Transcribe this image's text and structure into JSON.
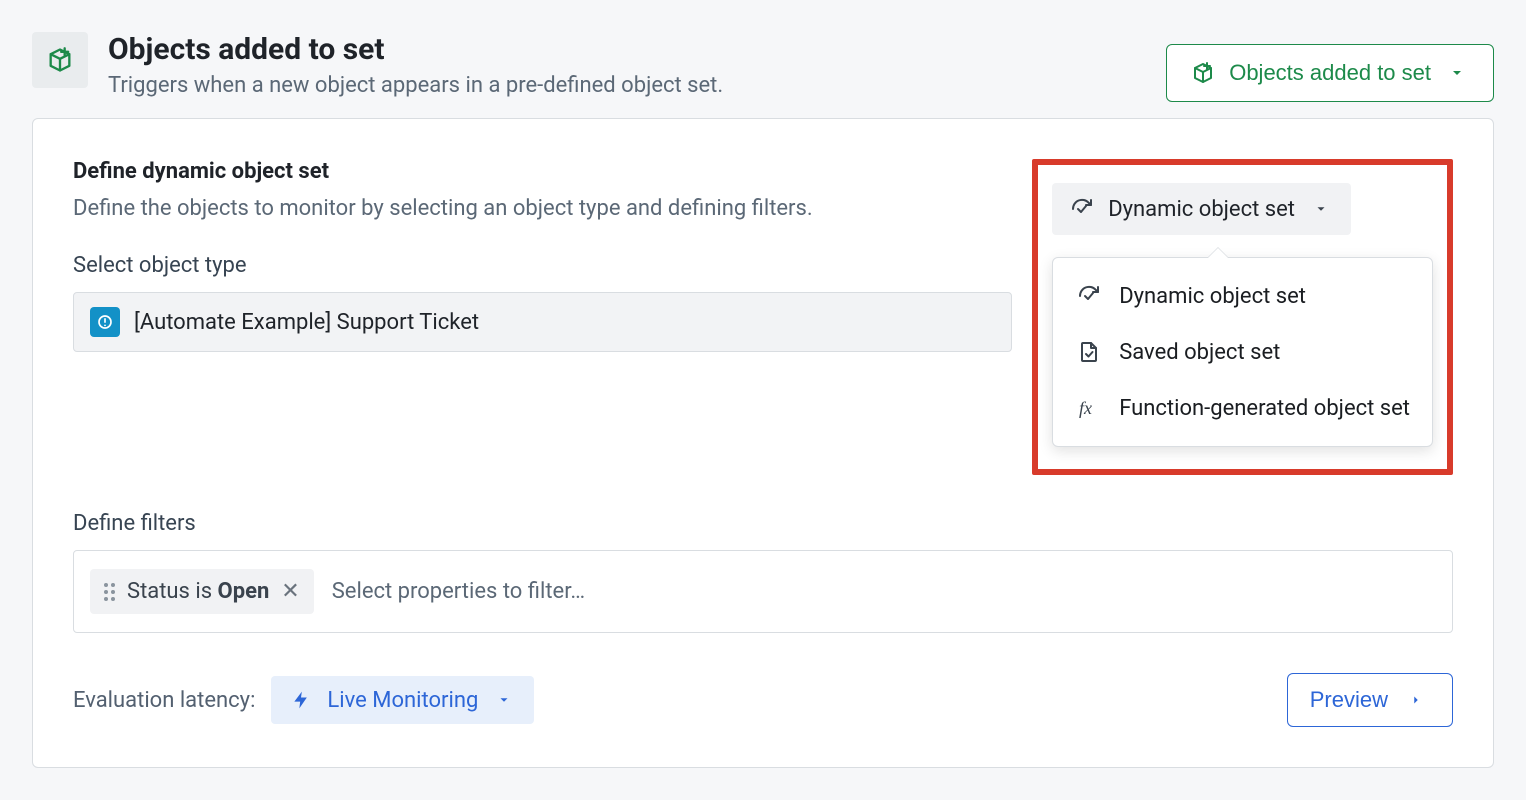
{
  "header": {
    "title": "Objects added to set",
    "description": "Triggers when a new object appears in a pre-defined object set.",
    "button_label": "Objects added to set"
  },
  "section": {
    "title": "Define dynamic object set",
    "description": "Define the objects to monitor by selecting an object type and defining filters.",
    "select_label": "Select object type",
    "object_type": "[Automate Example] Support Ticket",
    "filters_label": "Define filters",
    "filter_chip_prefix": "Status is ",
    "filter_chip_value": "Open",
    "filter_placeholder": "Select properties to filter…"
  },
  "dropdown": {
    "trigger_label": "Dynamic object set",
    "items": [
      "Dynamic object set",
      "Saved object set",
      "Function-generated object set"
    ]
  },
  "bottom": {
    "eval_label": "Evaluation latency:",
    "eval_value": "Live Monitoring",
    "preview_label": "Preview"
  }
}
